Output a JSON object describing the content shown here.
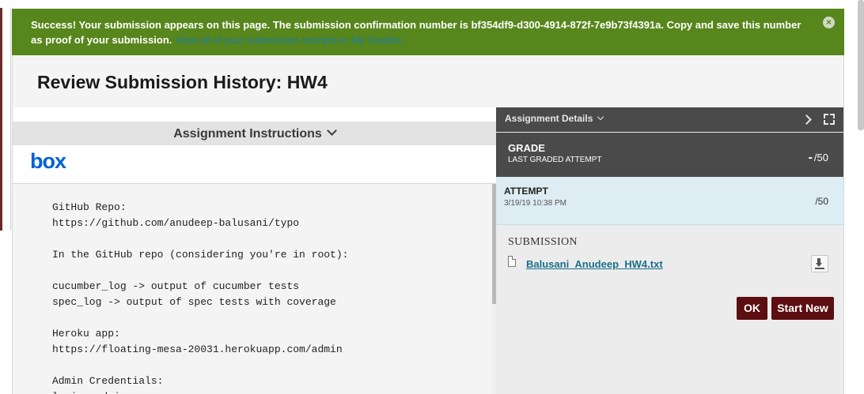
{
  "banner": {
    "message": "Success! Your submission appears on this page. The submission confirmation number is bf354df9-d300-4914-872f-7e9b73f4391a. Copy and save this number as proof of your submission.",
    "link_text": "View all of your submission receipts in My Grades.",
    "close_icon": "close-icon",
    "color": "#57861c"
  },
  "header": {
    "title": "Review Submission History: HW4"
  },
  "instructions": {
    "header_label": "Assignment Instructions",
    "logo_text": "box",
    "logo_color": "#0061d5",
    "body_text": "GitHub Repo:\nhttps://github.com/anudeep-balusani/typo\n\nIn the GitHub repo (considering you're in root):\n\ncucumber_log -> output of cucumber tests\nspec_log -> output of spec tests with coverage\n\nHeroku app:\nhttps://floating-mesa-20031.herokuapp.com/admin\n\nAdmin Credentials:\nlogin: admin"
  },
  "details": {
    "header_label": "Assignment Details",
    "grade": {
      "title": "GRADE",
      "subtitle": "LAST GRADED ATTEMPT",
      "score_prefix": "-",
      "score_total": "/50"
    },
    "attempt": {
      "title": "ATTEMPT",
      "date": "3/19/19 10:38 PM",
      "score": "/50"
    },
    "submission": {
      "label": "SUBMISSION",
      "file_name": "Balusani_Anudeep_HW4.txt"
    },
    "buttons": {
      "ok": "OK",
      "start_new": "Start New"
    },
    "button_color": "#5c0e11"
  }
}
